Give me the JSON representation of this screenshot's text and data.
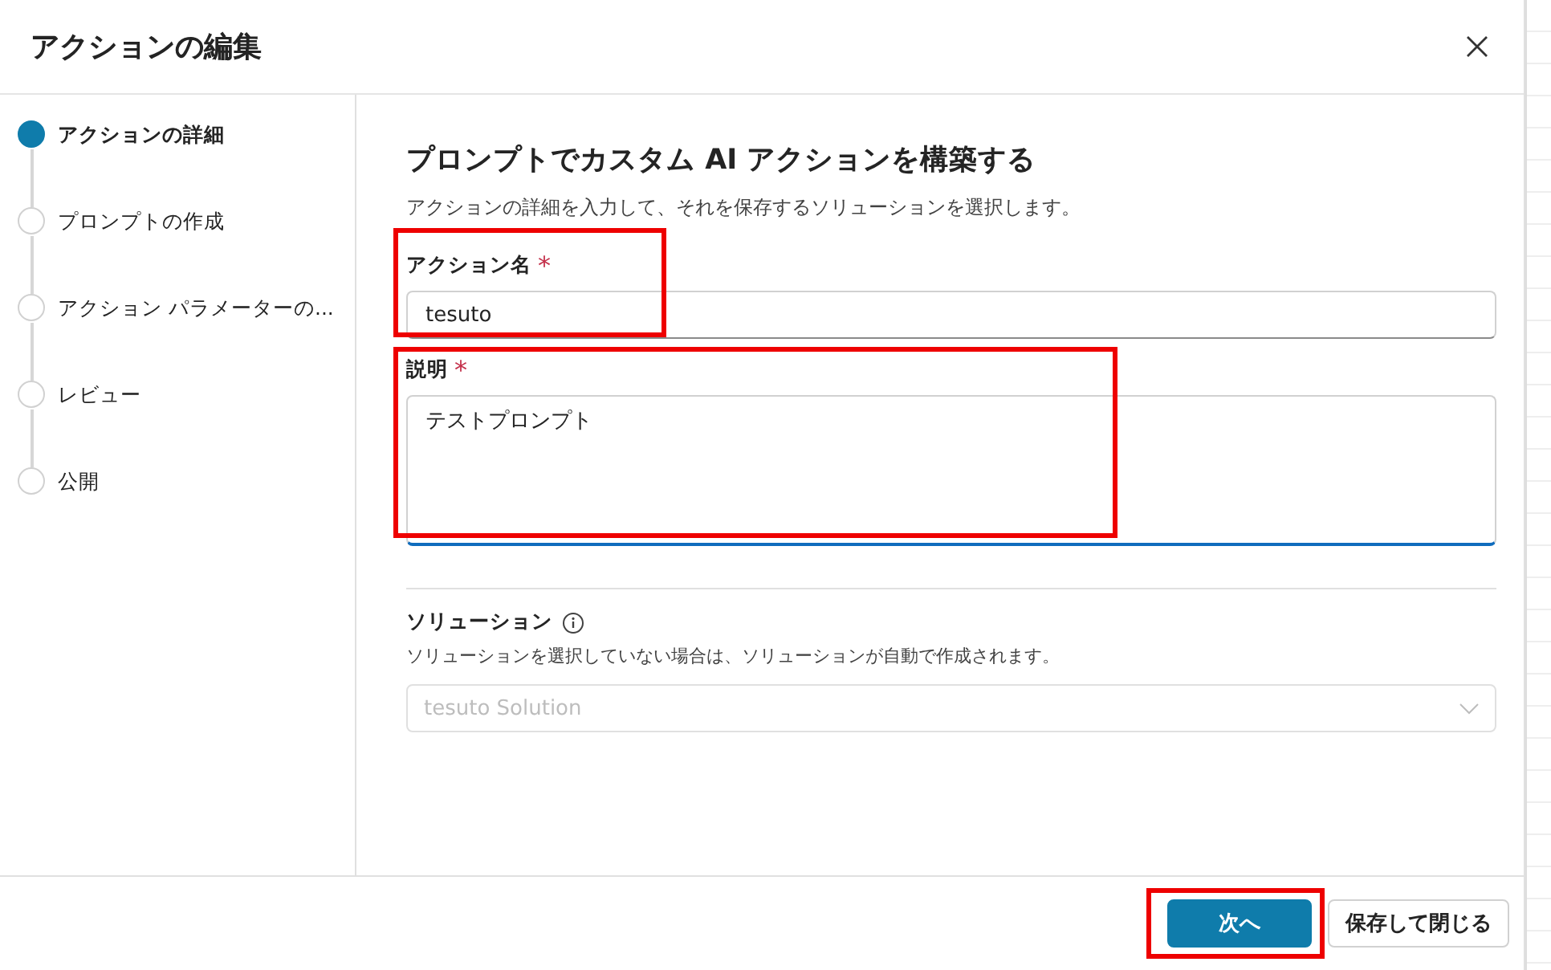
{
  "dialog": {
    "title": "アクションの編集"
  },
  "steps": [
    {
      "label": "アクションの詳細",
      "selected": true
    },
    {
      "label": "プロンプトの作成",
      "selected": false
    },
    {
      "label": "アクション パラメーターの...",
      "selected": false
    },
    {
      "label": "レビュー",
      "selected": false
    },
    {
      "label": "公開",
      "selected": false
    }
  ],
  "heading": "プロンプトでカスタム AI アクションを構築する",
  "subtitle": "アクションの詳細を入力して、それを保存するソリューションを選択します。",
  "fields": [
    {
      "kind": "text",
      "label": "アクション名",
      "required_mark": "*",
      "value": "tesuto",
      "focused": false,
      "highlighted": true
    },
    {
      "kind": "textarea",
      "label": "説明",
      "required_mark": "*",
      "value": "テストプロンプト",
      "focused": true,
      "highlighted": true
    }
  ],
  "solution": {
    "label": "ソリューション",
    "hint": "ソリューションを選択していない場合は、ソリューションが自動で作成されます。",
    "value": "tesuto Solution",
    "disabled": true
  },
  "buttons": [
    {
      "kind": "primary",
      "label": "次へ",
      "highlighted": true
    },
    {
      "kind": "secondary",
      "label": "保存して閉じる"
    }
  ]
}
